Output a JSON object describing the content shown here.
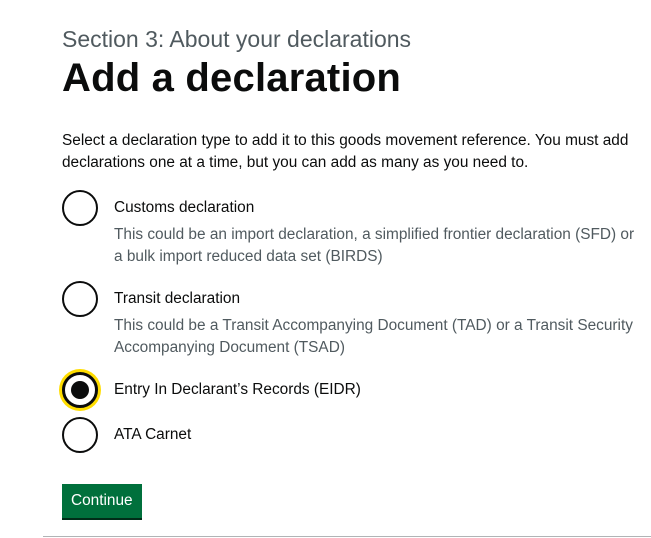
{
  "caption": "Section 3: About your declarations",
  "heading": "Add a declaration",
  "intro": "Select a declaration type to add it to this goods movement reference. You must add declarations one at a time, but you can add as many as you need to.",
  "options": [
    {
      "label": "Customs declaration",
      "hint": "This could be an import declaration, a simplified frontier declaration (SFD) or a bulk import reduced data set (BIRDS)",
      "checked": false
    },
    {
      "label": "Transit declaration",
      "hint": "This could be a Transit Accompanying Document (TAD) or a Transit Security Accompanying Document (TSAD)",
      "checked": false
    },
    {
      "label": "Entry In Declarant’s Records (EIDR)",
      "hint": "",
      "checked": true
    },
    {
      "label": "ATA Carnet",
      "hint": "",
      "checked": false
    }
  ],
  "continue_label": "Continue",
  "colors": {
    "text": "#0b0c0c",
    "secondary_text": "#505a5f",
    "button_green": "#00703c",
    "focus_yellow": "#ffdd00"
  }
}
